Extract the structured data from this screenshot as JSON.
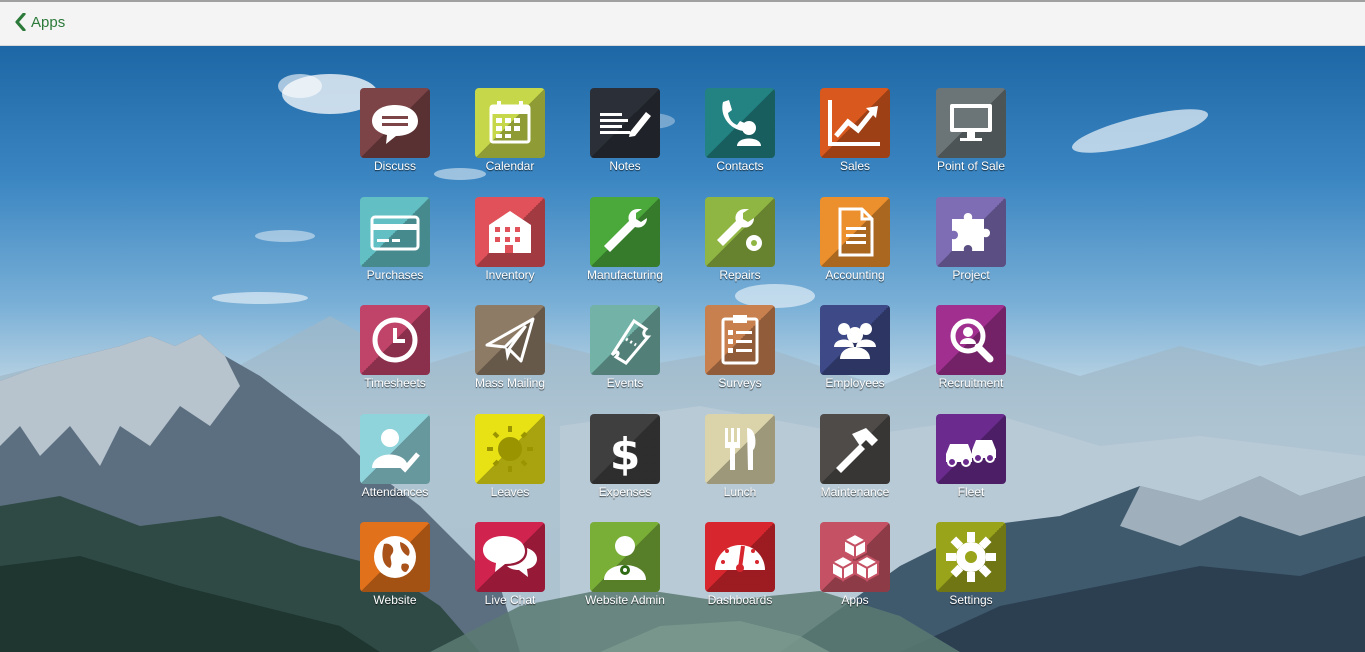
{
  "header": {
    "back_label": "Apps"
  },
  "apps": [
    {
      "label": "Discuss",
      "color": "#7d4447",
      "icon": "chat-bubble-icon"
    },
    {
      "label": "Calendar",
      "color": "#c6d84a",
      "icon": "calendar-icon"
    },
    {
      "label": "Notes",
      "color": "#2b2f37",
      "icon": "notes-pencil-icon"
    },
    {
      "label": "Contacts",
      "color": "#238282",
      "icon": "phone-person-icon"
    },
    {
      "label": "Sales",
      "color": "#d9581e",
      "icon": "sales-chart-icon"
    },
    {
      "label": "Point of Sale",
      "color": "#6b7477",
      "icon": "monitor-icon"
    },
    {
      "label": "Purchases",
      "color": "#62bfc4",
      "icon": "credit-card-icon"
    },
    {
      "label": "Inventory",
      "color": "#e0515a",
      "icon": "warehouse-building-icon"
    },
    {
      "label": "Manufacturing",
      "color": "#4ba93c",
      "icon": "wrench-icon"
    },
    {
      "label": "Repairs",
      "color": "#8fb543",
      "icon": "wrench-gear-icon"
    },
    {
      "label": "Accounting",
      "color": "#ec8f2d",
      "icon": "document-icon"
    },
    {
      "label": "Project",
      "color": "#7e6cb5",
      "icon": "puzzle-icon"
    },
    {
      "label": "Timesheets",
      "color": "#c0436a",
      "icon": "clock-icon"
    },
    {
      "label": "Mass Mailing",
      "color": "#8d7b65",
      "icon": "paper-plane-icon"
    },
    {
      "label": "Events",
      "color": "#72b2a7",
      "icon": "ticket-icon"
    },
    {
      "label": "Surveys",
      "color": "#c9804f",
      "icon": "clipboard-checklist-icon"
    },
    {
      "label": "Employees",
      "color": "#3e4a88",
      "icon": "people-group-icon"
    },
    {
      "label": "Recruitment",
      "color": "#a02f8f",
      "icon": "magnify-person-icon"
    },
    {
      "label": "Attendances",
      "color": "#8fd3db",
      "icon": "person-check-icon"
    },
    {
      "label": "Leaves",
      "color": "#e8e215",
      "icon": "sun-icon"
    },
    {
      "label": "Expenses",
      "color": "#3f3f3f",
      "icon": "dollar-icon"
    },
    {
      "label": "Lunch",
      "color": "#dbd3aa",
      "icon": "fork-knife-icon"
    },
    {
      "label": "Maintenance",
      "color": "#4e4b49",
      "icon": "hammer-icon"
    },
    {
      "label": "Fleet",
      "color": "#6a2a8e",
      "icon": "cars-icon"
    },
    {
      "label": "Website",
      "color": "#e2711c",
      "icon": "globe-icon"
    },
    {
      "label": "Live Chat",
      "color": "#d0234d",
      "icon": "chat-bubbles-icon"
    },
    {
      "label": "Website Admin",
      "color": "#79ae37",
      "icon": "person-gear-icon"
    },
    {
      "label": "Dashboards",
      "color": "#d8262f",
      "icon": "gauge-icon"
    },
    {
      "label": "Apps",
      "color": "#c55264",
      "icon": "cubes-icon"
    },
    {
      "label": "Settings",
      "color": "#9aa41a",
      "icon": "gear-icon"
    }
  ]
}
